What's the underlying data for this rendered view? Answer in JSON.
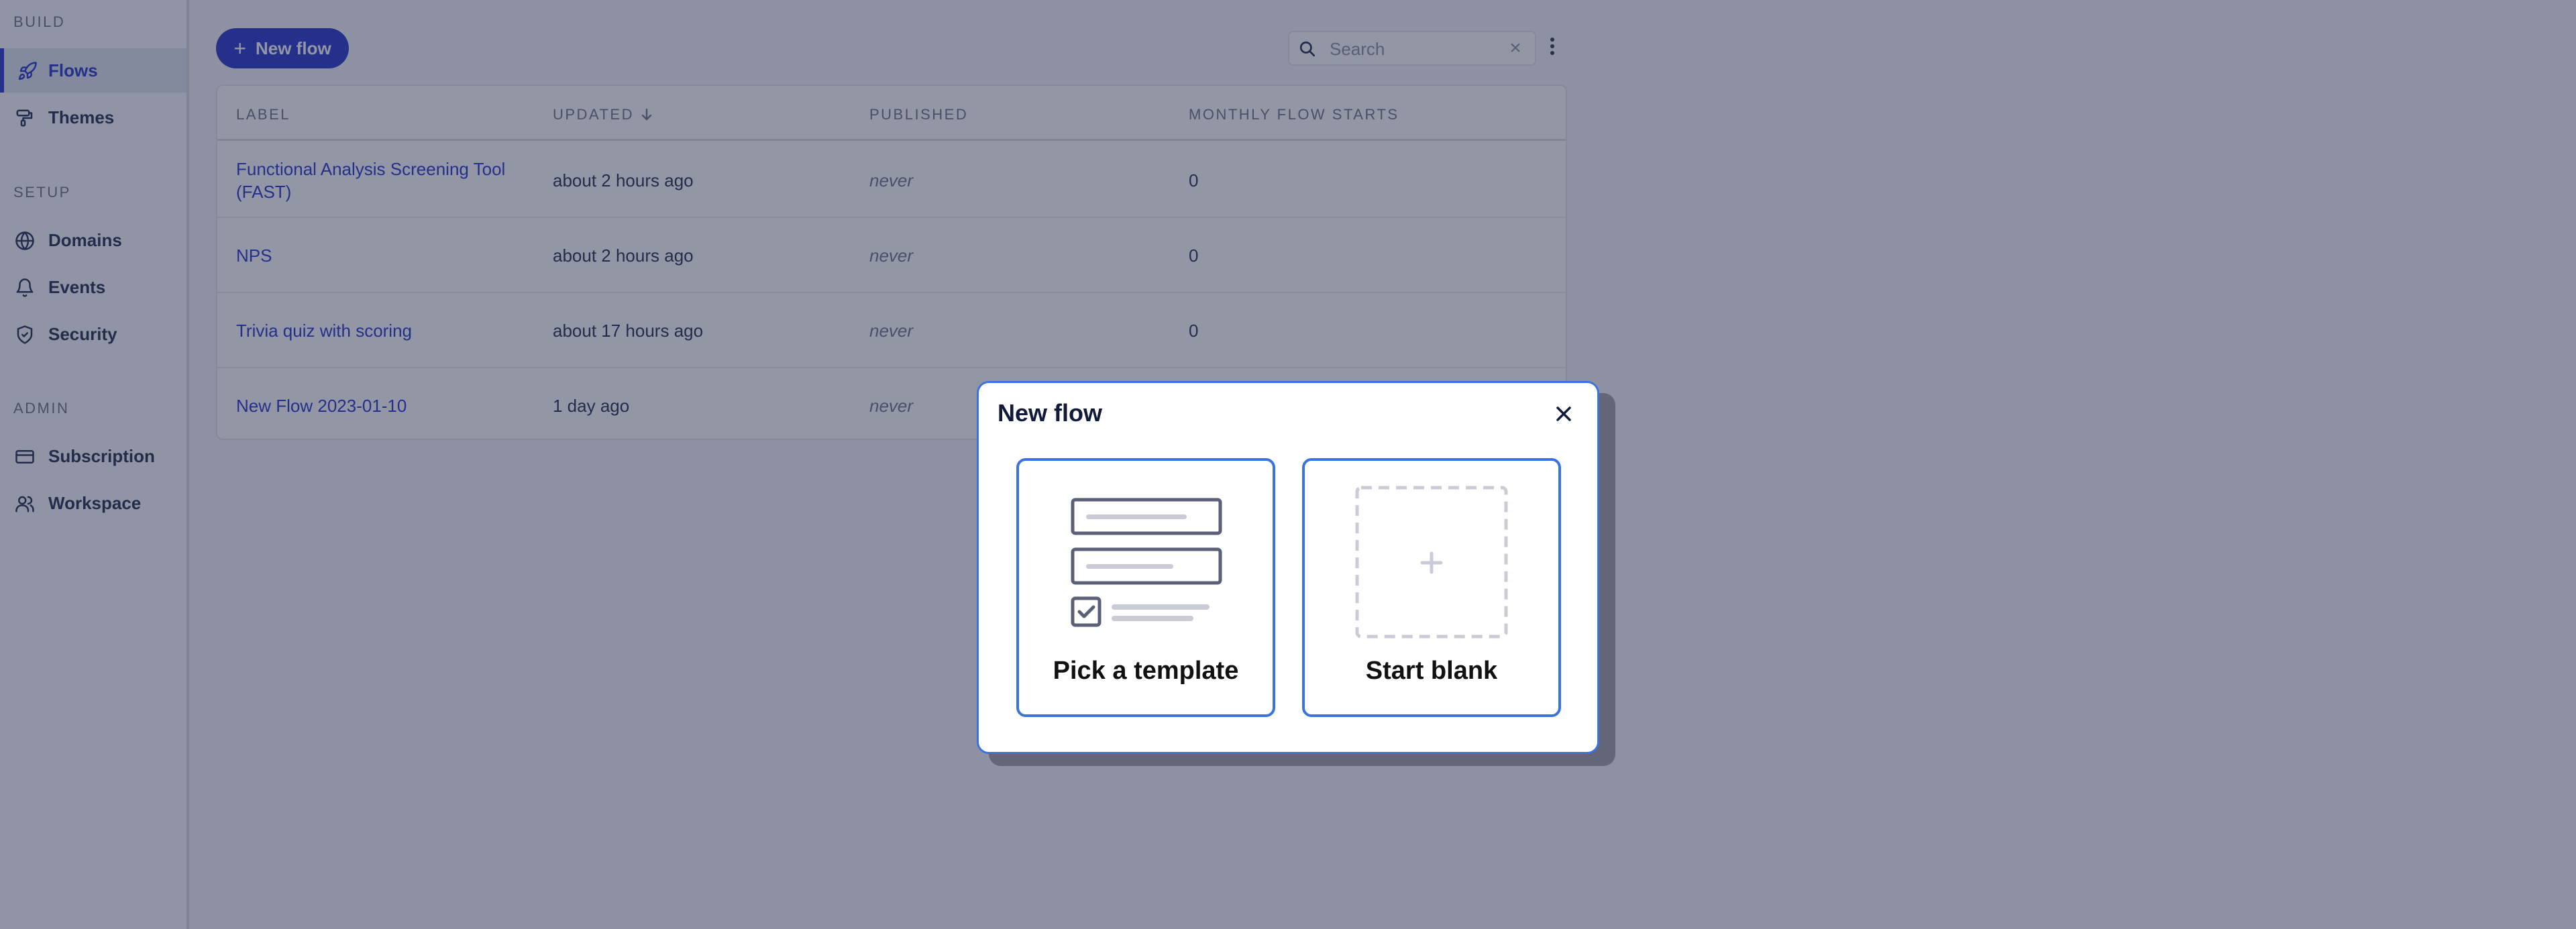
{
  "sidebar": {
    "sections": [
      {
        "title": "BUILD",
        "items": [
          {
            "label": "Flows",
            "icon": "rocket-icon",
            "active": true
          },
          {
            "label": "Themes",
            "icon": "paint-roller-icon"
          }
        ]
      },
      {
        "title": "SETUP",
        "items": [
          {
            "label": "Domains",
            "icon": "globe-icon"
          },
          {
            "label": "Events",
            "icon": "bell-icon"
          },
          {
            "label": "Security",
            "icon": "shield-check-icon"
          }
        ]
      },
      {
        "title": "ADMIN",
        "items": [
          {
            "label": "Subscription",
            "icon": "credit-card-icon"
          },
          {
            "label": "Workspace",
            "icon": "users-icon"
          }
        ]
      }
    ]
  },
  "toolbar": {
    "new_flow_label": "New flow",
    "search_placeholder": "Search"
  },
  "table": {
    "headers": [
      "LABEL",
      "UPDATED",
      "PUBLISHED",
      "MONTHLY FLOW STARTS"
    ],
    "sort_column": "UPDATED",
    "rows": [
      {
        "label": "Functional Analysis Screening Tool (FAST)",
        "updated": "about 2 hours ago",
        "published": "never",
        "starts": "0"
      },
      {
        "label": "NPS",
        "updated": "about 2 hours ago",
        "published": "never",
        "starts": "0"
      },
      {
        "label": "Trivia quiz with scoring",
        "updated": "about 17 hours ago",
        "published": "never",
        "starts": "0"
      },
      {
        "label": "New Flow 2023-01-10",
        "updated": "1 day ago",
        "published": "never",
        "starts": ""
      }
    ]
  },
  "modal": {
    "title": "New flow",
    "options": [
      {
        "label": "Pick a template",
        "icon": "template-form-icon"
      },
      {
        "label": "Start blank",
        "icon": "blank-plus-icon"
      }
    ]
  },
  "colors": {
    "accent": "#2233c9",
    "modal_border": "#3a73e0",
    "overlay": "rgba(38,45,75,0.5)"
  }
}
